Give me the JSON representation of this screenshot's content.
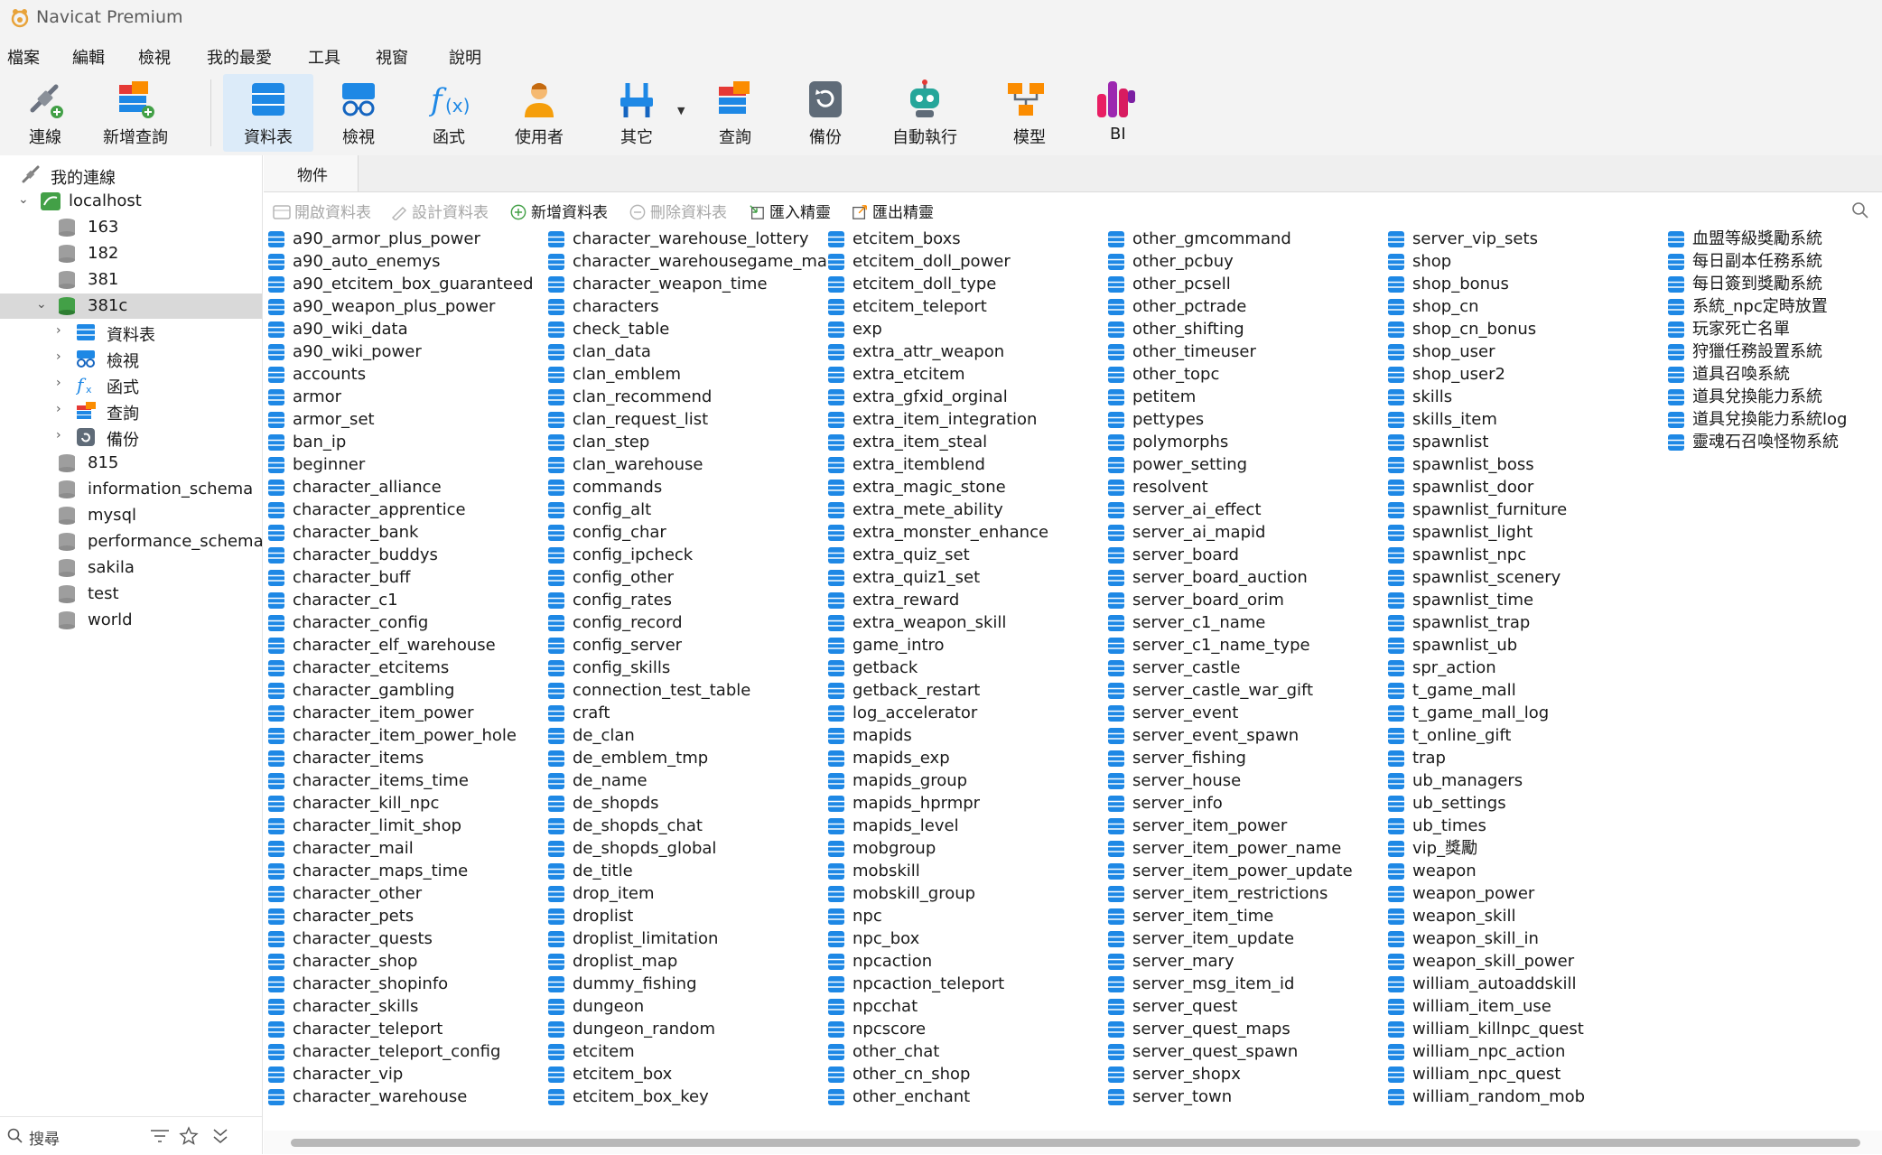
{
  "app": {
    "title": "Navicat Premium"
  },
  "menu": [
    "檔案",
    "編輯",
    "檢視",
    "我的最愛",
    "工具",
    "視窗",
    "說明"
  ],
  "toolbar": [
    {
      "label": "連線",
      "icon": "connection-icon"
    },
    {
      "label": "新增查詢",
      "icon": "new-query-icon"
    },
    {
      "label": "資料表",
      "icon": "table-icon",
      "active": true
    },
    {
      "label": "檢視",
      "icon": "view-icon"
    },
    {
      "label": "函式",
      "icon": "function-icon"
    },
    {
      "label": "使用者",
      "icon": "user-icon"
    },
    {
      "label": "其它",
      "icon": "other-icon"
    },
    {
      "label": "查詢",
      "icon": "query-icon"
    },
    {
      "label": "備份",
      "icon": "backup-icon"
    },
    {
      "label": "自動執行",
      "icon": "automation-icon"
    },
    {
      "label": "模型",
      "icon": "model-icon"
    },
    {
      "label": "BI",
      "icon": "bi-icon"
    }
  ],
  "sidebar": {
    "root": "我的連線",
    "connection": "localhost",
    "databases": [
      "163",
      "182",
      "381",
      "381c",
      "815",
      "information_schema",
      "mysql",
      "performance_schema",
      "sakila",
      "test",
      "world"
    ],
    "selected_db": "381c",
    "db_children": [
      "資料表",
      "檢視",
      "函式",
      "查詢",
      "備份"
    ],
    "search_placeholder": "搜尋"
  },
  "objects_tab": "物件",
  "object_toolbar": [
    {
      "label": "開啟資料表",
      "enabled": false
    },
    {
      "label": "設計資料表",
      "enabled": false
    },
    {
      "label": "新增資料表",
      "enabled": true
    },
    {
      "label": "刪除資料表",
      "enabled": false
    },
    {
      "label": "匯入精靈",
      "enabled": true
    },
    {
      "label": "匯出精靈",
      "enabled": true
    }
  ],
  "table_columns": [
    [
      "a90_armor_plus_power",
      "a90_auto_enemys",
      "a90_etcitem_box_guaranteed",
      "a90_weapon_plus_power",
      "a90_wiki_data",
      "a90_wiki_power",
      "accounts",
      "armor",
      "armor_set",
      "ban_ip",
      "beginner",
      "character_alliance",
      "character_apprentice",
      "character_bank",
      "character_buddys",
      "character_buff",
      "character_c1",
      "character_config",
      "character_elf_warehouse",
      "character_etcitems",
      "character_gambling",
      "character_item_power",
      "character_item_power_hole",
      "character_items",
      "character_items_time",
      "character_kill_npc",
      "character_limit_shop",
      "character_mail",
      "character_maps_time",
      "character_other",
      "character_pets",
      "character_quests",
      "character_shop",
      "character_shopinfo",
      "character_skills",
      "character_teleport",
      "character_teleport_config",
      "character_vip",
      "character_warehouse"
    ],
    [
      "character_warehouse_lottery",
      "character_warehousegame_mall",
      "character_weapon_time",
      "characters",
      "check_table",
      "clan_data",
      "clan_emblem",
      "clan_recommend",
      "clan_request_list",
      "clan_step",
      "clan_warehouse",
      "commands",
      "config_alt",
      "config_char",
      "config_ipcheck",
      "config_other",
      "config_rates",
      "config_record",
      "config_server",
      "config_skills",
      "connection_test_table",
      "craft",
      "de_clan",
      "de_emblem_tmp",
      "de_name",
      "de_shopds",
      "de_shopds_chat",
      "de_shopds_global",
      "de_title",
      "drop_item",
      "droplist",
      "droplist_limitation",
      "droplist_map",
      "dummy_fishing",
      "dungeon",
      "dungeon_random",
      "etcitem",
      "etcitem_box",
      "etcitem_box_key"
    ],
    [
      "etcitem_boxs",
      "etcitem_doll_power",
      "etcitem_doll_type",
      "etcitem_teleport",
      "exp",
      "extra_attr_weapon",
      "extra_etcitem",
      "extra_gfxid_orginal",
      "extra_item_integration",
      "extra_item_steal",
      "extra_itemblend",
      "extra_magic_stone",
      "extra_mete_ability",
      "extra_monster_enhance",
      "extra_quiz_set",
      "extra_quiz1_set",
      "extra_reward",
      "extra_weapon_skill",
      "game_intro",
      "getback",
      "getback_restart",
      "log_accelerator",
      "mapids",
      "mapids_exp",
      "mapids_group",
      "mapids_hprmpr",
      "mapids_level",
      "mobgroup",
      "mobskill",
      "mobskill_group",
      "npc",
      "npc_box",
      "npcaction",
      "npcaction_teleport",
      "npcchat",
      "npcscore",
      "other_chat",
      "other_cn_shop",
      "other_enchant"
    ],
    [
      "other_gmcommand",
      "other_pcbuy",
      "other_pcsell",
      "other_pctrade",
      "other_shifting",
      "other_timeuser",
      "other_topc",
      "petitem",
      "pettypes",
      "polymorphs",
      "power_setting",
      "resolvent",
      "server_ai_effect",
      "server_ai_mapid",
      "server_board",
      "server_board_auction",
      "server_board_orim",
      "server_c1_name",
      "server_c1_name_type",
      "server_castle",
      "server_castle_war_gift",
      "server_event",
      "server_event_spawn",
      "server_fishing",
      "server_house",
      "server_info",
      "server_item_power",
      "server_item_power_name",
      "server_item_power_update",
      "server_item_restrictions",
      "server_item_time",
      "server_item_update",
      "server_mary",
      "server_msg_item_id",
      "server_quest",
      "server_quest_maps",
      "server_quest_spawn",
      "server_shopx",
      "server_town"
    ],
    [
      "server_vip_sets",
      "shop",
      "shop_bonus",
      "shop_cn",
      "shop_cn_bonus",
      "shop_user",
      "shop_user2",
      "skills",
      "skills_item",
      "spawnlist",
      "spawnlist_boss",
      "spawnlist_door",
      "spawnlist_furniture",
      "spawnlist_light",
      "spawnlist_npc",
      "spawnlist_scenery",
      "spawnlist_time",
      "spawnlist_trap",
      "spawnlist_ub",
      "spr_action",
      "t_game_mall",
      "t_game_mall_log",
      "t_online_gift",
      "trap",
      "ub_managers",
      "ub_settings",
      "ub_times",
      "vip_獎勵",
      "weapon",
      "weapon_power",
      "weapon_skill",
      "weapon_skill_in",
      "weapon_skill_power",
      "william_autoaddskill",
      "william_item_use",
      "william_killnpc_quest",
      "william_npc_action",
      "william_npc_quest",
      "william_random_mob"
    ],
    [
      "血盟等級獎勵系統",
      "每日副本任務系統",
      "每日簽到獎勵系統",
      "系統_npc定時放置",
      "玩家死亡名單",
      "狩獵任務設置系統",
      "道具召喚系統",
      "道具兌換能力系統",
      "道具兌換能力系統log",
      "靈魂石召喚怪物系統"
    ]
  ],
  "colors": {
    "accent": "#1e88e5",
    "selection": "#d9d9d9",
    "active_tool": "#dcebf9"
  }
}
